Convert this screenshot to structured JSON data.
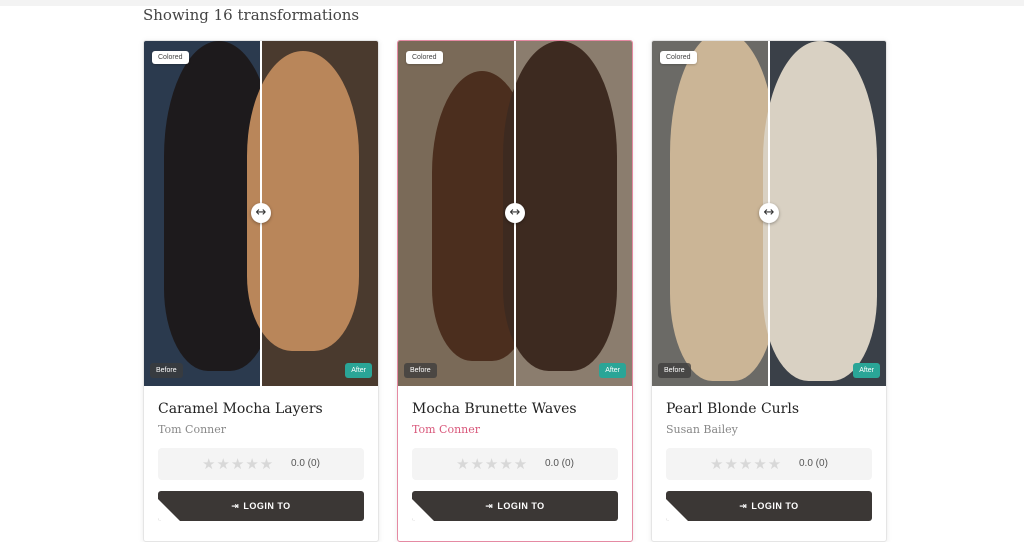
{
  "page": {
    "heading": "Showing 16 transformations"
  },
  "cards": [
    {
      "tag": "Colored",
      "before_label": "Before",
      "after_label": "After",
      "title": "Caramel Mocha Layers",
      "author": "Tom Conner",
      "rating": "0.0 (0)",
      "stars": "★★★★★",
      "login_label": "LOGIN TO",
      "colors": {
        "before_bg": "#2b3a4e",
        "before_hair": "#1d1a1c",
        "after_bg": "#4a3a2e",
        "after_hair": "#b9865a"
      }
    },
    {
      "tag": "Colored",
      "before_label": "Before",
      "after_label": "After",
      "title": "Mocha Brunette Waves",
      "author": "Tom Conner",
      "rating": "0.0 (0)",
      "stars": "★★★★★",
      "login_label": "LOGIN TO",
      "colors": {
        "before_bg": "#7a6a58",
        "before_hair": "#4b2e1e",
        "after_bg": "#8b7d6e",
        "after_hair": "#3d2a20"
      }
    },
    {
      "tag": "Colored",
      "before_label": "Before",
      "after_label": "After",
      "title": "Pearl Blonde Curls",
      "author": "Susan Bailey",
      "rating": "0.0 (0)",
      "stars": "★★★★★",
      "login_label": "LOGIN TO",
      "colors": {
        "before_bg": "#6b6a66",
        "before_hair": "#cbb596",
        "after_bg": "#3a4048",
        "after_hair": "#d9d1c3"
      }
    }
  ],
  "icons": {
    "compare_handle": "↔",
    "login": "⇥"
  }
}
